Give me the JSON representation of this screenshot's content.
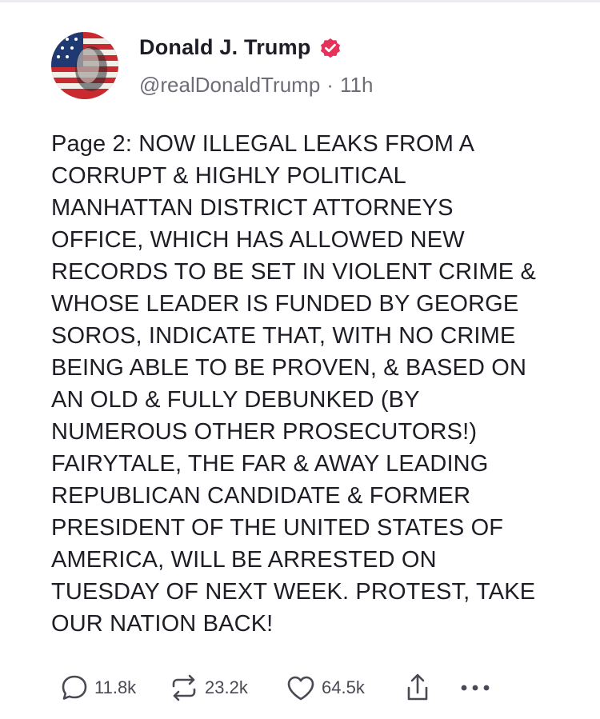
{
  "author": {
    "display_name": "Donald J. Trump",
    "handle": "@realDonaldTrump",
    "time_separator": "·",
    "timestamp": "11h",
    "verified_badge_color": "#e8315a"
  },
  "post": {
    "lines": [
      "Page 2: NOW ILLEGAL LEAKS FROM A",
      "CORRUPT & HIGHLY POLITICAL",
      "MANHATTAN DISTRICT ATTORNEYS",
      "OFFICE, WHICH HAS ALLOWED NEW",
      "RECORDS TO BE SET IN VIOLENT CRIME &",
      "WHOSE LEADER IS FUNDED BY GEORGE",
      "SOROS, INDICATE THAT, WITH NO CRIME",
      "BEING ABLE TO BE PROVEN, & BASED ON",
      "AN OLD & FULLY DEBUNKED (BY",
      "NUMEROUS OTHER PROSECUTORS!)",
      "FAIRYTALE, THE FAR & AWAY LEADING",
      "REPUBLICAN CANDIDATE & FORMER",
      "PRESIDENT OF THE UNITED STATES OF",
      "AMERICA, WILL BE ARRESTED ON",
      "TUESDAY OF NEXT WEEK. PROTEST, TAKE",
      "OUR NATION BACK!"
    ]
  },
  "actions": {
    "replies": {
      "icon": "reply-icon",
      "count": "11.8k"
    },
    "retruths": {
      "icon": "retruth-icon",
      "count": "23.2k"
    },
    "likes": {
      "icon": "heart-icon",
      "count": "64.5k"
    },
    "share": {
      "icon": "share-icon"
    },
    "more": {
      "icon": "more-icon"
    }
  },
  "colors": {
    "text": "#1d1d26",
    "muted": "#6d6d78",
    "icon": "#4a4a55"
  }
}
